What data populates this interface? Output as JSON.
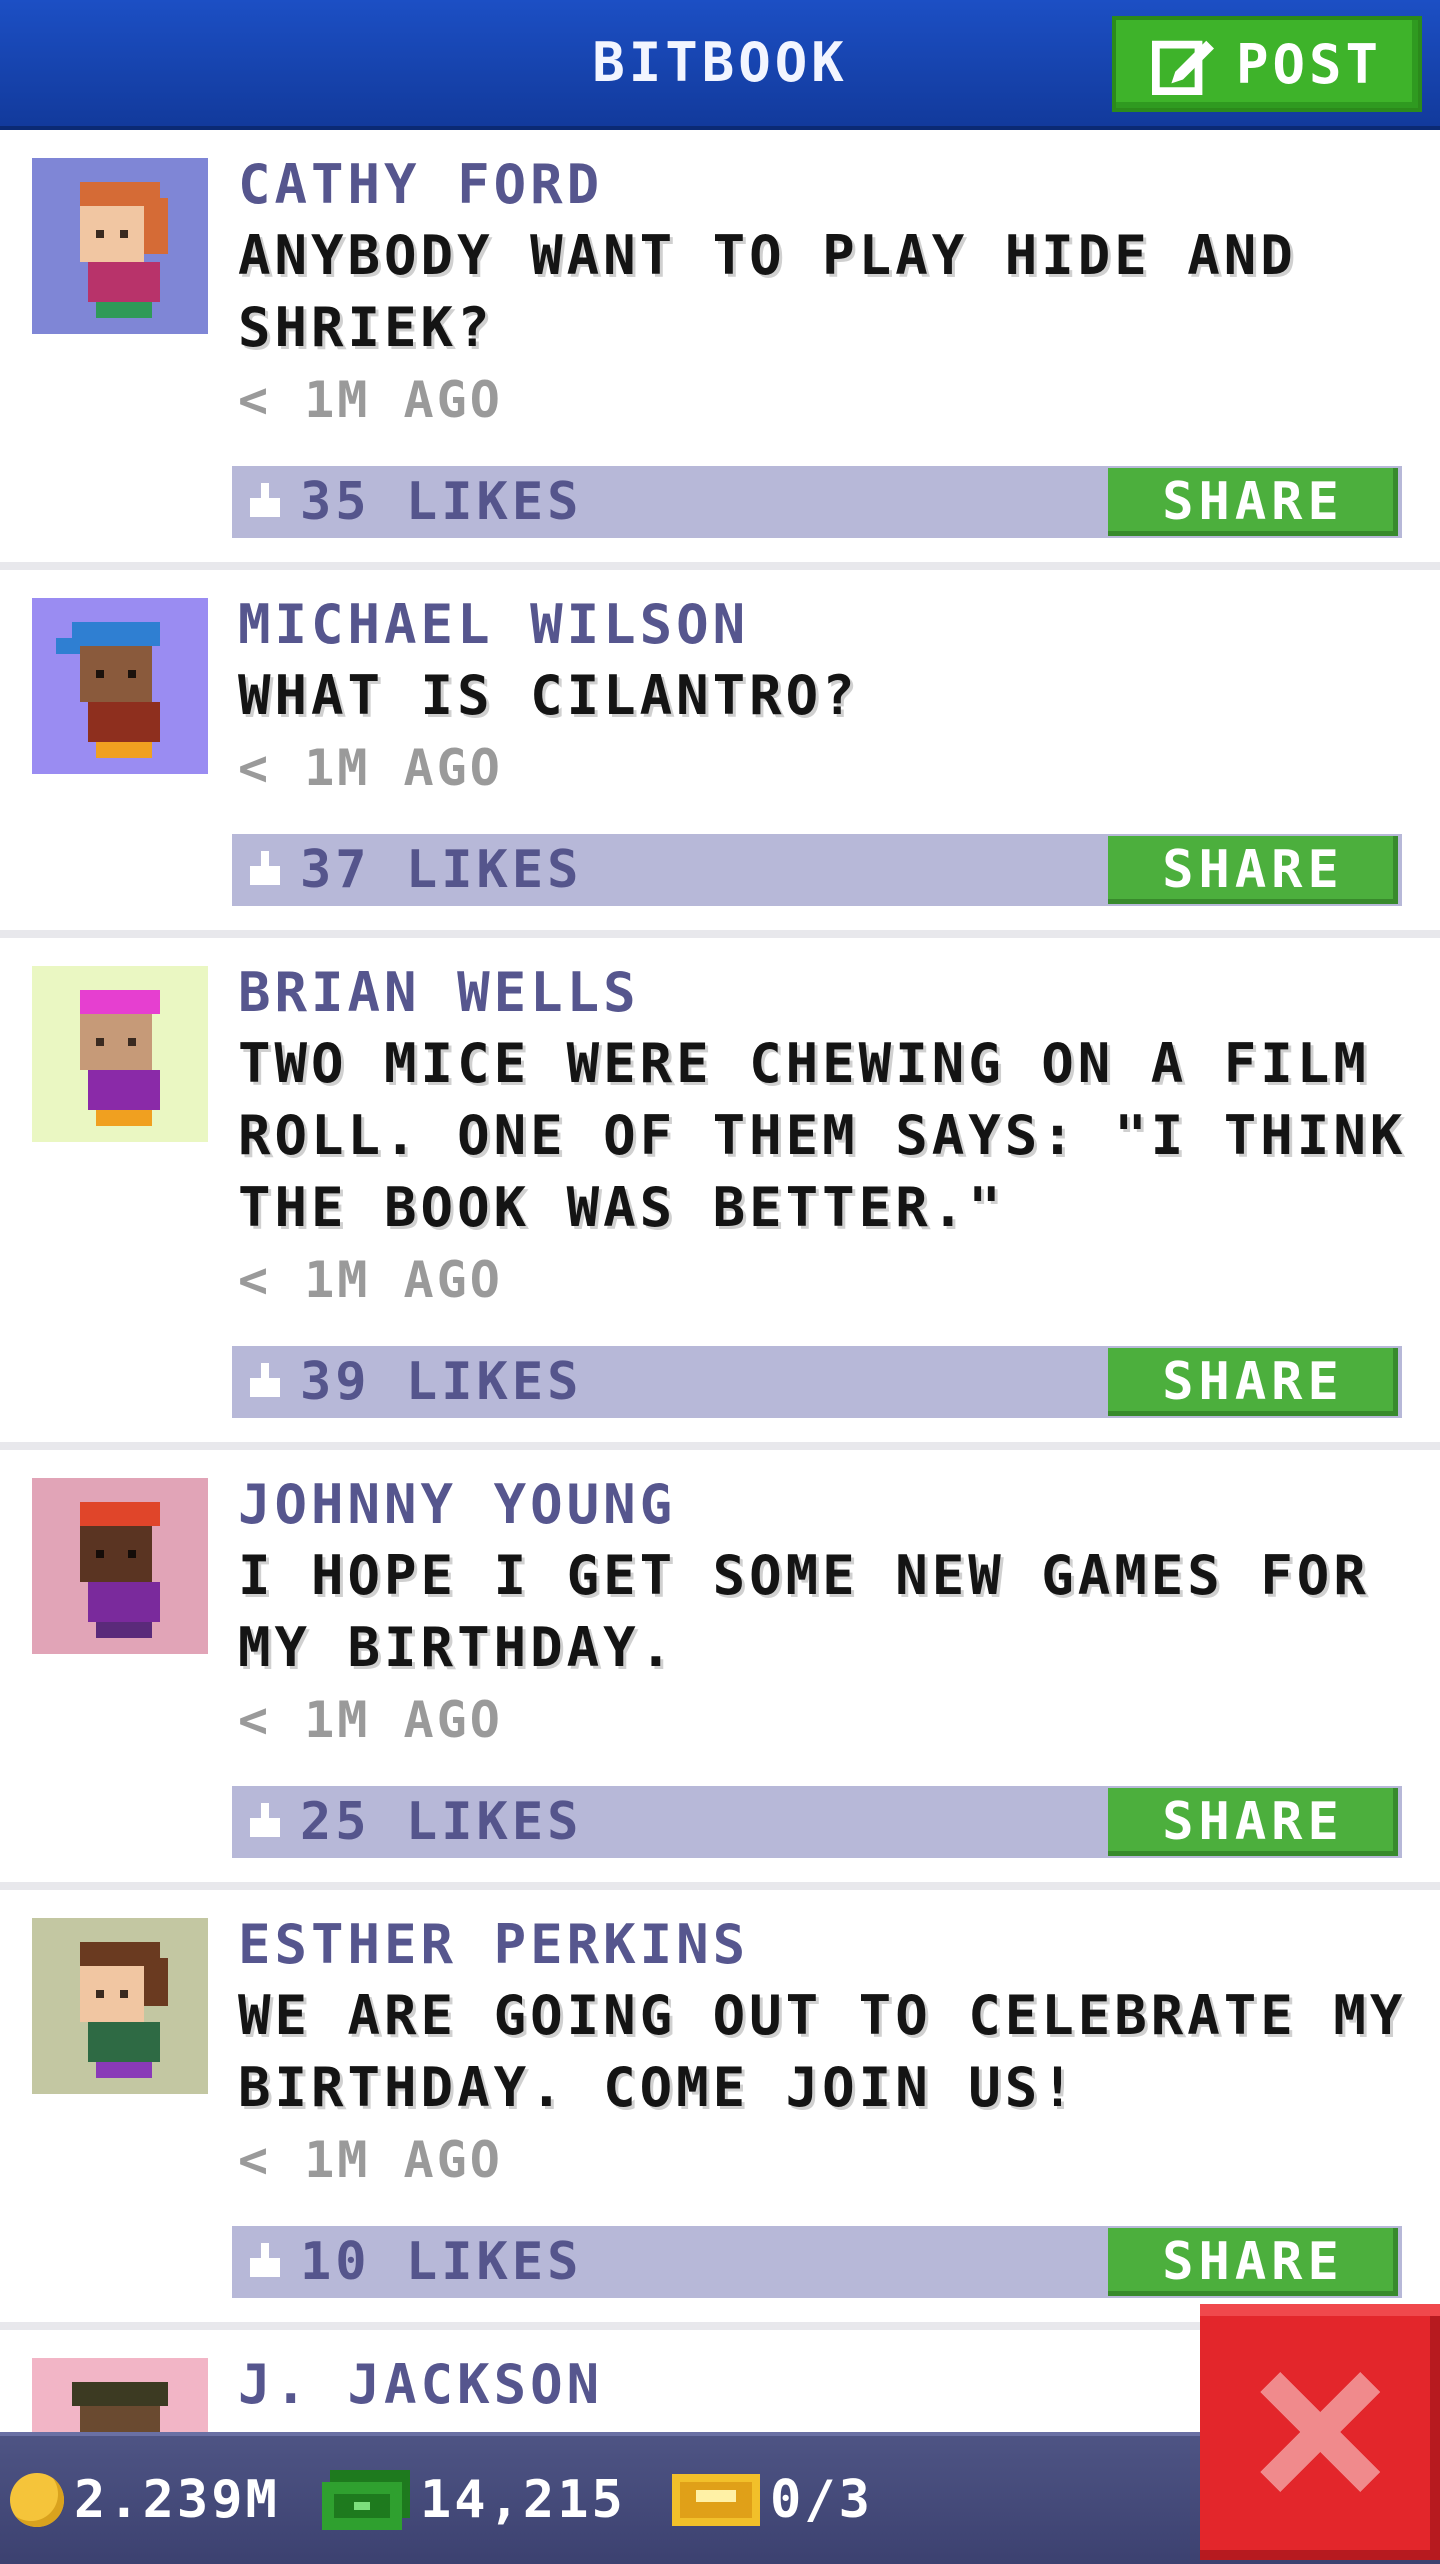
{
  "header": {
    "title": "BITBOOK",
    "post_label": "POST"
  },
  "posts": [
    {
      "author": "CATHY FORD",
      "message": "ANYBODY WANT TO PLAY HIDE AND SHRIEK?",
      "time": "< 1M AGO",
      "likes": "35 LIKES",
      "share_label": "SHARE",
      "avatar_bg": "#7f86d6"
    },
    {
      "author": "MICHAEL WILSON",
      "message": "WHAT IS CILANTRO?",
      "time": "< 1M AGO",
      "likes": "37 LIKES",
      "share_label": "SHARE",
      "avatar_bg": "#9a8cf2"
    },
    {
      "author": "BRIAN WELLS",
      "message": "TWO MICE WERE CHEWING ON A FILM ROLL. ONE OF THEM SAYS: \"I THINK THE BOOK WAS BETTER.\"",
      "time": "< 1M AGO",
      "likes": "39 LIKES",
      "share_label": "SHARE",
      "avatar_bg": "#eaf7c2"
    },
    {
      "author": "JOHNNY YOUNG",
      "message": "I HOPE I GET SOME NEW GAMES FOR MY BIRTHDAY.",
      "time": "< 1M AGO",
      "likes": "25 LIKES",
      "share_label": "SHARE",
      "avatar_bg": "#e1a4b7"
    },
    {
      "author": "ESTHER PERKINS",
      "message": "WE ARE GOING OUT TO CELEBRATE MY BIRTHDAY. COME JOIN US!",
      "time": "< 1M AGO",
      "likes": "10 LIKES",
      "share_label": "SHARE",
      "avatar_bg": "#c3c7a2"
    },
    {
      "author": "J. JACKSON",
      "avatar_bg": "#f2b5c6"
    }
  ],
  "status_bar": {
    "coins": "2.239M",
    "cash": "14,215",
    "tickets": "0/3"
  },
  "colors": {
    "header": "#1c4fc4",
    "post_button": "#3eb32a",
    "like_bar": "#b7b8d8",
    "share_button": "#4caf3d",
    "close_button": "#e3262b"
  }
}
